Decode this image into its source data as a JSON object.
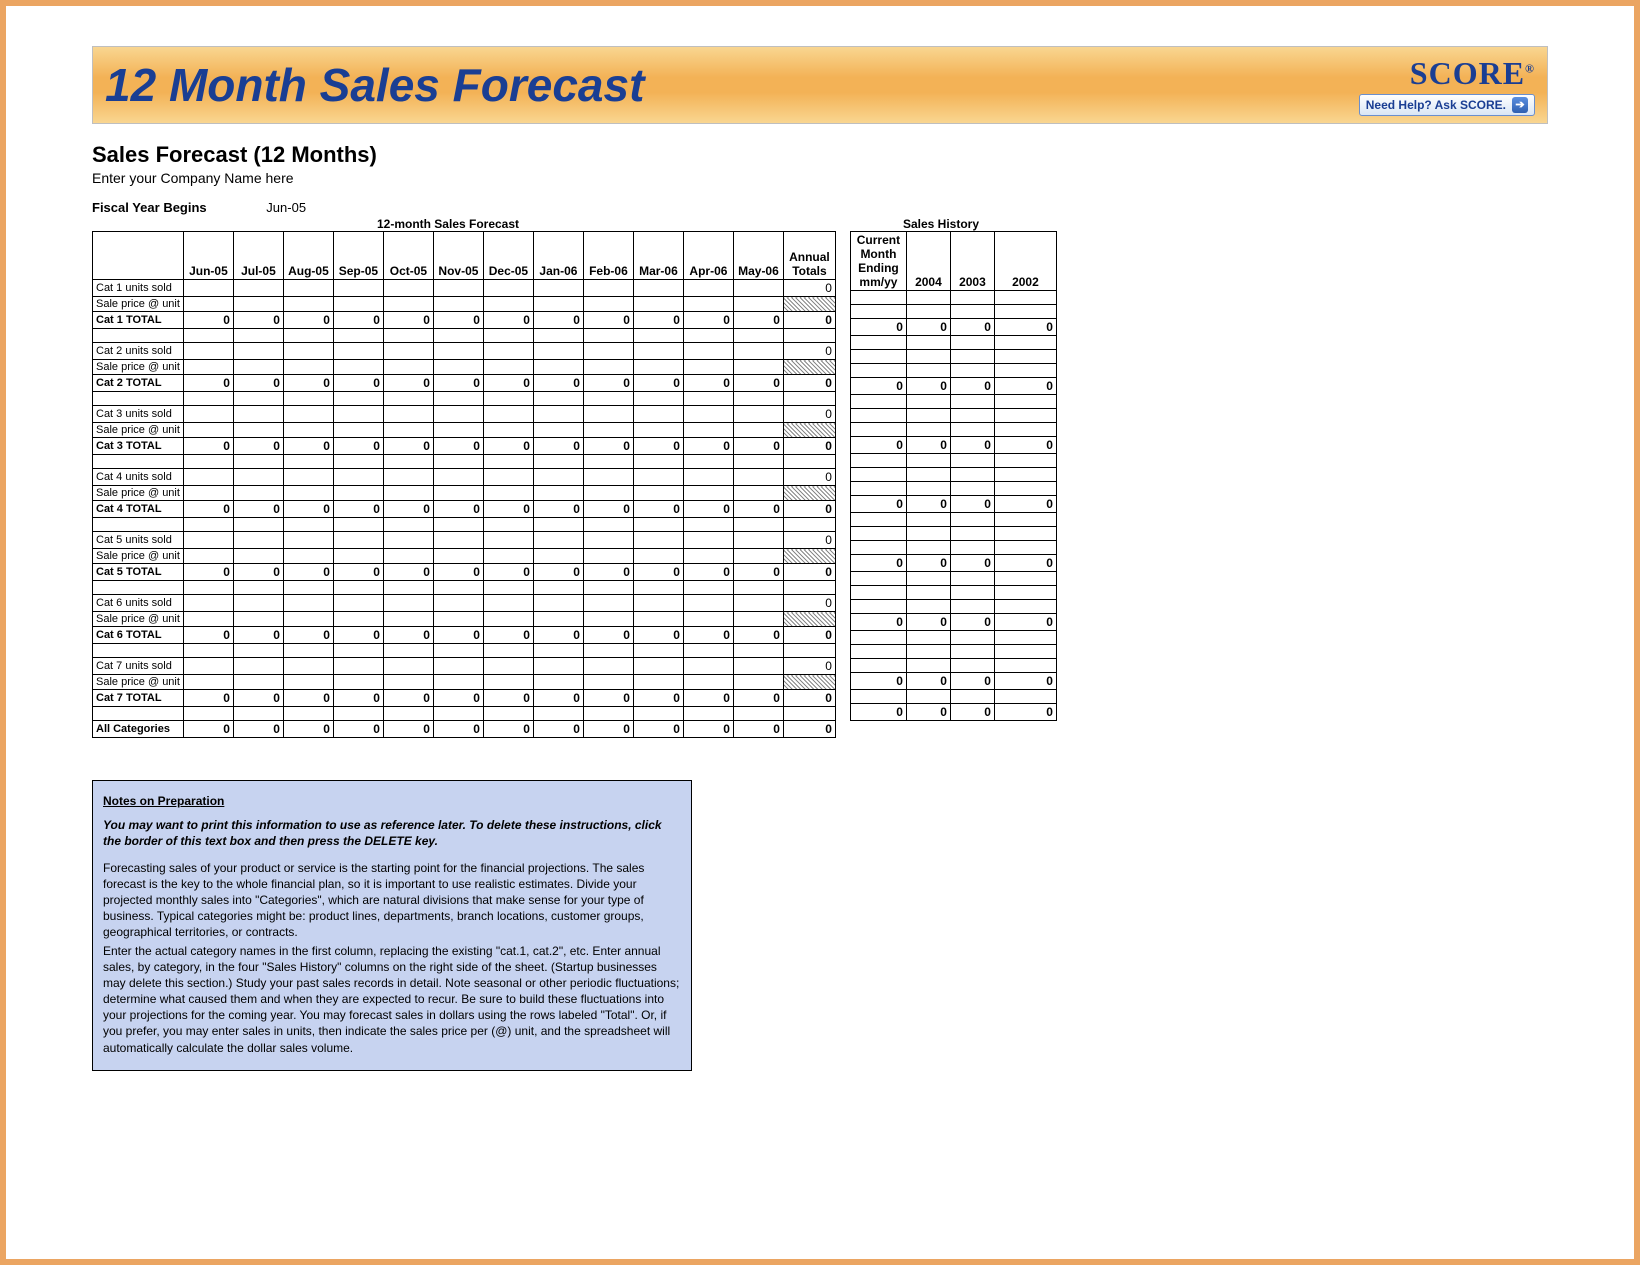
{
  "banner": {
    "title": "12 Month Sales Forecast",
    "logo_text": "SCORE",
    "logo_reg": "®",
    "help_label": "Need Help? Ask SCORE."
  },
  "header": {
    "section_title": "Sales Forecast (12 Months)",
    "company_prompt": "Enter your Company Name here",
    "fiscal_label": "Fiscal Year Begins",
    "fiscal_value": "Jun-05",
    "forecast_caption": "12-month Sales Forecast",
    "history_caption": "Sales History"
  },
  "forecast": {
    "months": [
      "Jun-05",
      "Jul-05",
      "Aug-05",
      "Sep-05",
      "Oct-05",
      "Nov-05",
      "Dec-05",
      "Jan-06",
      "Feb-06",
      "Mar-06",
      "Apr-06",
      "May-06"
    ],
    "annual_header": "Annual Totals",
    "row_labels": {
      "units": "units sold",
      "price": "Sale price @ unit",
      "total": "TOTAL",
      "all": "All Categories"
    },
    "categories": [
      {
        "name": "Cat 1",
        "units_annual": "0",
        "total_vals": [
          "0",
          "0",
          "0",
          "0",
          "0",
          "0",
          "0",
          "0",
          "0",
          "0",
          "0",
          "0"
        ],
        "total_annual": "0"
      },
      {
        "name": "Cat 2",
        "units_annual": "0",
        "total_vals": [
          "0",
          "0",
          "0",
          "0",
          "0",
          "0",
          "0",
          "0",
          "0",
          "0",
          "0",
          "0"
        ],
        "total_annual": "0"
      },
      {
        "name": "Cat 3",
        "units_annual": "0",
        "total_vals": [
          "0",
          "0",
          "0",
          "0",
          "0",
          "0",
          "0",
          "0",
          "0",
          "0",
          "0",
          "0"
        ],
        "total_annual": "0"
      },
      {
        "name": "Cat 4",
        "units_annual": "0",
        "total_vals": [
          "0",
          "0",
          "0",
          "0",
          "0",
          "0",
          "0",
          "0",
          "0",
          "0",
          "0",
          "0"
        ],
        "total_annual": "0"
      },
      {
        "name": "Cat 5",
        "units_annual": "0",
        "total_vals": [
          "0",
          "0",
          "0",
          "0",
          "0",
          "0",
          "0",
          "0",
          "0",
          "0",
          "0",
          "0"
        ],
        "total_annual": "0"
      },
      {
        "name": "Cat 6",
        "units_annual": "0",
        "total_vals": [
          "0",
          "0",
          "0",
          "0",
          "0",
          "0",
          "0",
          "0",
          "0",
          "0",
          "0",
          "0"
        ],
        "total_annual": "0"
      },
      {
        "name": "Cat 7",
        "units_annual": "0",
        "total_vals": [
          "0",
          "0",
          "0",
          "0",
          "0",
          "0",
          "0",
          "0",
          "0",
          "0",
          "0",
          "0"
        ],
        "total_annual": "0"
      }
    ],
    "all_row": {
      "vals": [
        "0",
        "0",
        "0",
        "0",
        "0",
        "0",
        "0",
        "0",
        "0",
        "0",
        "0",
        "0"
      ],
      "annual": "0"
    }
  },
  "history": {
    "current_header": "Current Month Ending mm/yy",
    "year_headers": [
      "2004",
      "2003",
      "2002"
    ],
    "category_totals": [
      {
        "vals": [
          "0",
          "0",
          "0",
          "0"
        ]
      },
      {
        "vals": [
          "0",
          "0",
          "0",
          "0"
        ]
      },
      {
        "vals": [
          "0",
          "0",
          "0",
          "0"
        ]
      },
      {
        "vals": [
          "0",
          "0",
          "0",
          "0"
        ]
      },
      {
        "vals": [
          "0",
          "0",
          "0",
          "0"
        ]
      },
      {
        "vals": [
          "0",
          "0",
          "0",
          "0"
        ]
      },
      {
        "vals": [
          "0",
          "0",
          "0",
          "0"
        ]
      }
    ],
    "all_row": [
      "0",
      "0",
      "0",
      "0"
    ]
  },
  "notes": {
    "title": "Notes on Preparation",
    "lead": "You may want to print this information to use as reference later. To delete these instructions, click the border of this text box and then press the DELETE key.",
    "para1": "Forecasting sales of your product or service is the starting point for the financial projections. The sales forecast is the key to the whole financial plan, so it is important to use realistic estimates. Divide your projected monthly sales into \"Categories\", which are natural divisions that make sense for your type of business. Typical categories might be: product lines, departments, branch locations, customer groups, geographical territories, or contracts.",
    "para2": "Enter the actual category names in the first column, replacing the existing \"cat.1, cat.2\", etc. Enter annual sales, by category, in the four \"Sales History\" columns on the right side of the sheet. (Startup businesses may delete this section.) Study your past sales records in detail. Note seasonal or other periodic fluctuations; determine what caused them and when they are expected to recur. Be sure to build these fluctuations into your projections for the coming year. You may forecast sales in dollars using the rows labeled \"Total\".  Or, if you prefer, you may enter sales in units, then indicate the sales price per (@) unit, and the spreadsheet will automatically calculate the dollar sales volume."
  }
}
